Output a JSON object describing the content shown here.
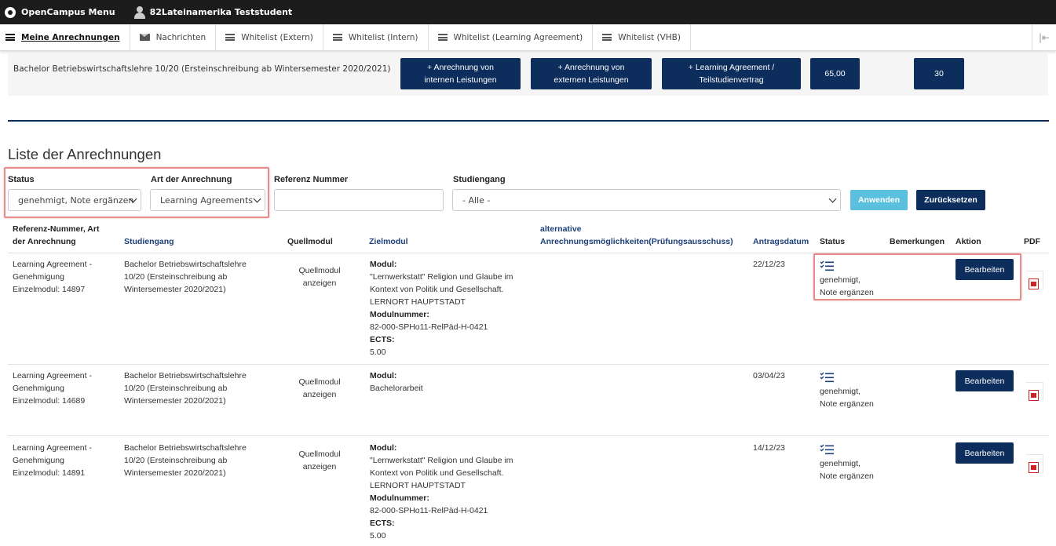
{
  "topbar": {
    "menu_label": "OpenCampus Menu",
    "user_label": "82Lateinamerika Teststudent"
  },
  "tabs": [
    {
      "label": "Meine Anrechnungen"
    },
    {
      "label": "Nachrichten"
    },
    {
      "label": "Whitelist (Extern)"
    },
    {
      "label": "Whitelist (Intern)"
    },
    {
      "label": "Whitelist (Learning Agreement)"
    },
    {
      "label": "Whitelist (VHB)"
    }
  ],
  "collapse_icon": "arrow-left-bar",
  "summary": {
    "degree": "Bachelor Betriebswirtschaftslehre 10/20 (Ersteinschreibung ab Wintersemester 2020/2021)",
    "btn_internal_1": "+ Anrechnung von",
    "btn_internal_2": "internen Leistungen",
    "btn_external_1": "+ Anrechnung von",
    "btn_external_2": "externen Leistungen",
    "btn_la_1": "+ Learning Agreement /",
    "btn_la_2": "Teilstudienvertrag",
    "value_1": "65,00",
    "value_2": "30"
  },
  "list": {
    "title": "Liste der Anrechnungen",
    "filters": {
      "status_label": "Status",
      "status_value": "genehmigt, Note ergänzen",
      "art_label": "Art der Anrechnung",
      "art_value": "Learning Agreements",
      "ref_label": "Referenz Nummer",
      "studiengang_label": "Studiengang",
      "studiengang_value": "- Alle -",
      "apply_label": "Anwenden",
      "reset_label": "Zurücksetzen"
    },
    "headers": {
      "ref_1": "Referenz-Nummer, Art",
      "ref_2": "der Anrechnung",
      "studiengang": "Studiengang",
      "quellmodul": "Quellmodul",
      "zielmodul": "Zielmodul",
      "alt_1": "alternative",
      "alt_2": "Anrechnungsmöglichkeiten(Prüfungsausschuss)",
      "antragsdatum": "Antragsdatum",
      "status": "Status",
      "bemerkungen": "Bemerkungen",
      "aktion": "Aktion",
      "pdf": "PDF"
    },
    "rows": [
      {
        "ref_1": "Learning Agreement -",
        "ref_2": "Genehmigung",
        "ref_3": "Einzelmodul: 14897",
        "sg_1": "Bachelor Betriebswirtschaftslehre",
        "sg_2": "10/20 (Ersteinschreibung ab",
        "sg_3": "Wintersemester 2020/2021)",
        "qm_1": "Quellmodul",
        "qm_2": "anzeigen",
        "zm_label": "Modul:",
        "zm_1": "\"Lernwerkstatt\" Religion und Glaube im",
        "zm_2": "Kontext von Politik und Gesellschaft.",
        "zm_3": "LERNORT HAUPTSTADT",
        "zm_num_label": "Modulnummer:",
        "zm_num": "82-000-SPHo11-RelPäd-H-0421",
        "zm_ects_label": "ECTS:",
        "zm_ects": "5.00",
        "date": "22/12/23",
        "status_1": "genehmigt,",
        "status_2": "Note ergänzen",
        "action": "Bearbeiten"
      },
      {
        "ref_1": "Learning Agreement -",
        "ref_2": "Genehmigung",
        "ref_3": "Einzelmodul: 14689",
        "sg_1": "Bachelor Betriebswirtschaftslehre",
        "sg_2": "10/20 (Ersteinschreibung ab",
        "sg_3": "Wintersemester 2020/2021)",
        "qm_1": "Quellmodul",
        "qm_2": "anzeigen",
        "zm_label": "Modul:",
        "zm_1": "Bachelorarbeit",
        "date": "03/04/23",
        "status_1": "genehmigt,",
        "status_2": "Note ergänzen",
        "action": "Bearbeiten"
      },
      {
        "ref_1": "Learning Agreement -",
        "ref_2": "Genehmigung",
        "ref_3": "Einzelmodul: 14891",
        "sg_1": "Bachelor Betriebswirtschaftslehre",
        "sg_2": "10/20 (Ersteinschreibung ab",
        "sg_3": "Wintersemester 2020/2021)",
        "qm_1": "Quellmodul",
        "qm_2": "anzeigen",
        "zm_label": "Modul:",
        "zm_1": "\"Lernwerkstatt\" Religion und Glaube im",
        "zm_2": "Kontext von Politik und Gesellschaft.",
        "zm_3": "LERNORT HAUPTSTADT",
        "zm_num_label": "Modulnummer:",
        "zm_num": "82-000-SPHo11-RelPäd-H-0421",
        "zm_ects_label": "ECTS:",
        "zm_ects": "5.00",
        "date": "14/12/23",
        "status_1": "genehmigt,",
        "status_2": "Note ergänzen",
        "action": "Bearbeiten"
      }
    ]
  },
  "colors": {
    "navy": "#0d2d5c",
    "apply": "#5bc0de",
    "highlight": "#e88b8b",
    "pdf": "#cc2222"
  },
  "icons": {
    "status": "checklist-icon",
    "pdf": "pdf-icon"
  }
}
